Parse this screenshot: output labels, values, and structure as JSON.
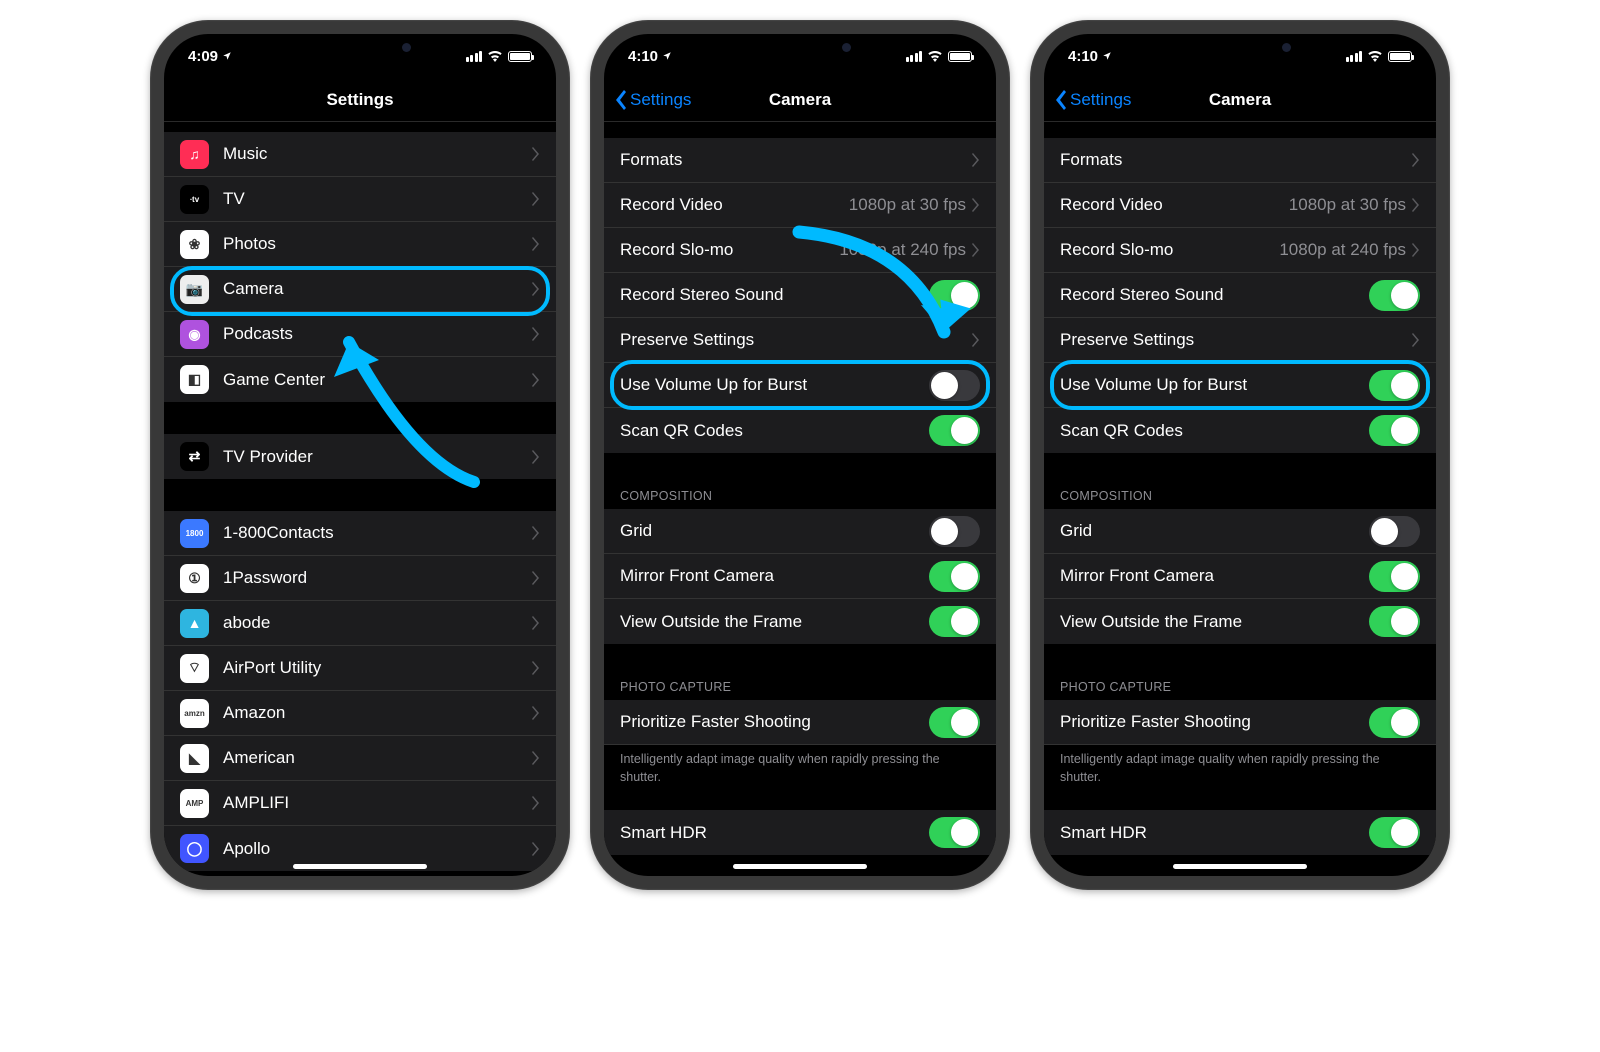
{
  "status": {
    "time1": "4:09",
    "time2": "4:10",
    "time3": "4:10"
  },
  "phone1": {
    "nav_title": "Settings",
    "groupA": [
      {
        "label": "Music",
        "bg": "#ff2d55",
        "glyph": "♫"
      },
      {
        "label": "TV",
        "bg": "#000",
        "glyph": "∙tv"
      },
      {
        "label": "Photos",
        "bg": "#fff",
        "glyph": "❀"
      },
      {
        "label": "Camera",
        "bg": "#eee",
        "glyph": "📷"
      },
      {
        "label": "Podcasts",
        "bg": "#af52de",
        "glyph": "◉"
      },
      {
        "label": "Game Center",
        "bg": "#fff",
        "glyph": "◧"
      }
    ],
    "groupB": [
      {
        "label": "TV Provider",
        "bg": "#000",
        "glyph": "⇄"
      }
    ],
    "groupC": [
      {
        "label": "1-800Contacts",
        "bg": "#3b79ff",
        "glyph": "1800"
      },
      {
        "label": "1Password",
        "bg": "#fff",
        "glyph": "①"
      },
      {
        "label": "abode",
        "bg": "#2eb5e0",
        "glyph": "▲"
      },
      {
        "label": "AirPort Utility",
        "bg": "#fff",
        "glyph": "⌔"
      },
      {
        "label": "Amazon",
        "bg": "#fff",
        "glyph": "amzn"
      },
      {
        "label": "American",
        "bg": "#fff",
        "glyph": "◣"
      },
      {
        "label": "AMPLIFI",
        "bg": "#fff",
        "glyph": "AMP"
      },
      {
        "label": "Apollo",
        "bg": "#4155ff",
        "glyph": "◯"
      }
    ]
  },
  "camera": {
    "nav_back": "Settings",
    "nav_title": "Camera",
    "rows": {
      "formats": "Formats",
      "record_video": "Record Video",
      "record_video_val": "1080p at 30 fps",
      "record_slomo": "Record Slo-mo",
      "record_slomo_val": "1080p at 240 fps",
      "record_stereo": "Record Stereo Sound",
      "preserve": "Preserve Settings",
      "volume_burst": "Use Volume Up for Burst",
      "scan_qr": "Scan QR Codes"
    },
    "composition_header": "COMPOSITION",
    "composition": {
      "grid": "Grid",
      "mirror": "Mirror Front Camera",
      "view_outside": "View Outside the Frame"
    },
    "photo_header": "PHOTO CAPTURE",
    "photo": {
      "prioritize": "Prioritize Faster Shooting",
      "footer": "Intelligently adapt image quality when rapidly pressing the shutter.",
      "smart_hdr": "Smart HDR"
    }
  }
}
